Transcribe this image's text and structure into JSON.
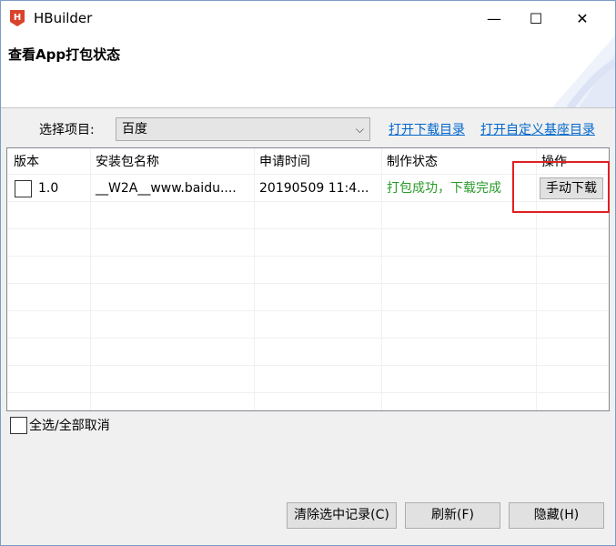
{
  "window": {
    "title": "HBuilder",
    "minimize_glyph": "—",
    "maximize_glyph": "☐",
    "close_glyph": "✕"
  },
  "header": {
    "title": "查看App打包状态"
  },
  "project": {
    "label": "选择项目:",
    "selected": "百度",
    "arrow": "⌵"
  },
  "links": {
    "open_download_dir": "打开下载目录",
    "open_custom_base_dir": "打开自定义基座目录"
  },
  "table": {
    "columns": [
      "版本",
      "安装包名称",
      "申请时间",
      "制作状态",
      "操作"
    ],
    "rows": [
      {
        "checked": false,
        "version": "1.0",
        "package_name": "__W2A__www.baidu....",
        "time": "20190509 11:4...",
        "status": "打包成功，下载完成",
        "action": "手动下载"
      }
    ]
  },
  "select_all": {
    "label": "全选/全部取消",
    "checked": false
  },
  "buttons": {
    "clear": "清除选中记录(C)",
    "refresh": "刷新(F)",
    "hide": "隐藏(H)"
  },
  "colors": {
    "status_success": "#2b9a2b",
    "link": "#0066cc",
    "highlight": "#e02020"
  }
}
